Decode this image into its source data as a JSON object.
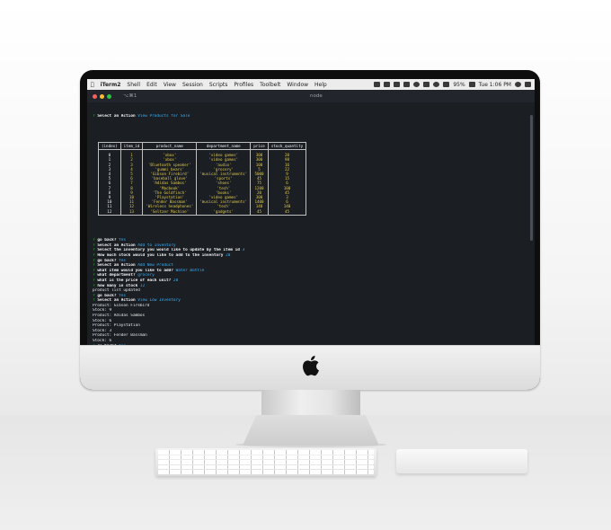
{
  "menubar": {
    "app": "iTerm2",
    "items": [
      "Shell",
      "Edit",
      "View",
      "Session",
      "Scripts",
      "Profiles",
      "Toolbelt",
      "Window",
      "Help"
    ],
    "battery": "95%",
    "clock": "Tue 1:06 PM"
  },
  "window": {
    "shortcut": "⌥⌘1",
    "title": "node"
  },
  "terminal": {
    "prompt_symbol": "?",
    "first_line": {
      "question": "Select an Action",
      "answer": "View Products for Sale"
    },
    "table": {
      "headers": [
        "(index)",
        "item_id",
        "product_name",
        "department_name",
        "price",
        "stock_quantity"
      ],
      "rows": [
        [
          "0",
          "1",
          "'xbox'",
          "'video games'",
          "300",
          "20"
        ],
        [
          "1",
          "2",
          "'xbox'",
          "'video games'",
          "300",
          "98"
        ],
        [
          "2",
          "3",
          "'Bluetooth speaker'",
          "'audio'",
          "100",
          "16"
        ],
        [
          "3",
          "4",
          "'gummi bears'",
          "'grocery'",
          "5",
          "22"
        ],
        [
          "4",
          "5",
          "'Gibson Firebird'",
          "'musical instruments'",
          "5000",
          "9"
        ],
        [
          "5",
          "6",
          "'baseball glove'",
          "'sports'",
          "45",
          "15"
        ],
        [
          "6",
          "7",
          "'Adidas Sambos'",
          "'shoes'",
          "75",
          "6"
        ],
        [
          "7",
          "8",
          "'Macbook'",
          "'tech'",
          "1200",
          "100"
        ],
        [
          "8",
          "9",
          "'The Goldfinch'",
          "'books'",
          "20",
          "45"
        ],
        [
          "9",
          "10",
          "'Playstation'",
          "'video games'",
          "300",
          "3"
        ],
        [
          "10",
          "11",
          "'Fender Bassman'",
          "'musical instruments'",
          "1400",
          "6"
        ],
        [
          "11",
          "12",
          "'Wireless headphones'",
          "'tech'",
          "140",
          "140"
        ],
        [
          "12",
          "13",
          "'Seltzer Machine'",
          "'gadgets'",
          "45",
          "45"
        ]
      ]
    },
    "lines": [
      {
        "q": "go back?",
        "a": "Yes"
      },
      {
        "q": "Select an Action",
        "a": "Add to Inventory"
      },
      {
        "q": "Select the inventory you would like to update by the item id",
        "a": "3"
      },
      {
        "q": "How much stock would you like to add to the inventory",
        "a": "20"
      },
      {
        "q": "go back?",
        "a": "Yes"
      },
      {
        "q": "Select an Action",
        "a": "Add New Product"
      },
      {
        "q": "what item would you like to add?",
        "a": "Water Bottle"
      },
      {
        "q": "what department?",
        "a": "grocery"
      },
      {
        "q": "what is the price of each unit?",
        "a": "20"
      },
      {
        "q": "how many in stock",
        "a": "12"
      },
      {
        "plain": "product list updated"
      },
      {
        "q": "go back?",
        "a": "Yes"
      },
      {
        "q": "Select an Action",
        "a": "View Low Inventory"
      },
      {
        "plain": "Product: Gibson Firebird"
      },
      {
        "plain": "Stock: 9"
      },
      {
        "plain": "Product: Adidas Sambos"
      },
      {
        "plain": "Stock: 6"
      },
      {
        "plain": "Product: Playstation"
      },
      {
        "plain": "Stock: 3"
      },
      {
        "plain": "Product: Fender Bassman"
      },
      {
        "plain": "Stock: 6"
      },
      {
        "q": "go back?",
        "a": "Yes"
      },
      {
        "q": "Select an Action",
        "a": "Add to Inventory"
      },
      {
        "q": "Select the inventory you would like to update by the item id",
        "a": "11"
      },
      {
        "q": "How much stock would you like to add to the inventory",
        "a": "20"
      }
    ]
  }
}
